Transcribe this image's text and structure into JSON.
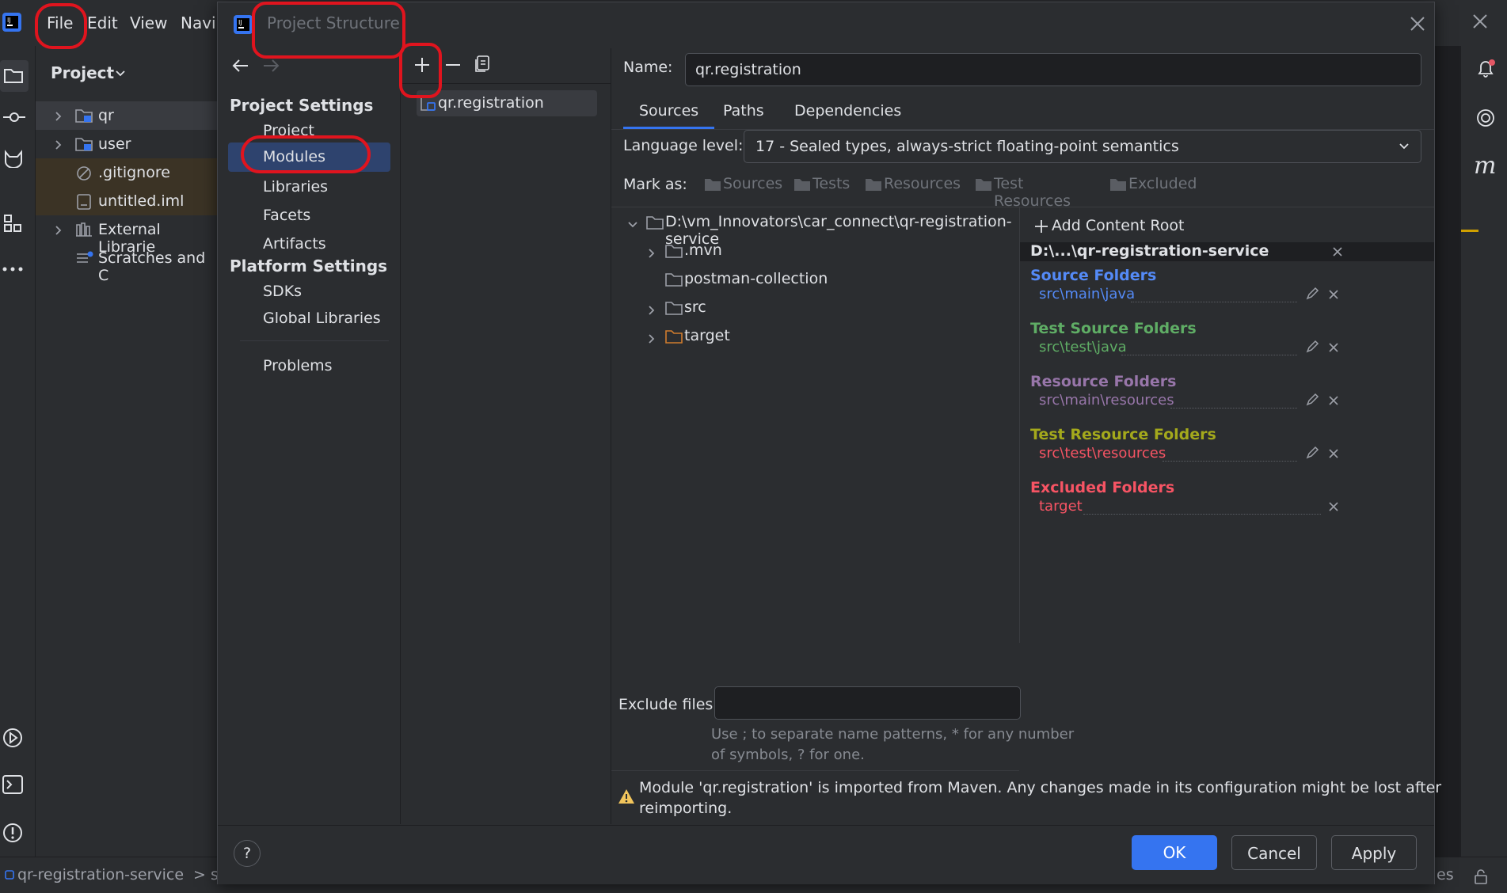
{
  "ide": {
    "menu": {
      "file": "File",
      "edit": "Edit",
      "view": "View",
      "navigate": "Navi"
    },
    "project_panel": {
      "title": "Project",
      "items": [
        {
          "label": "qr"
        },
        {
          "label": "user"
        },
        {
          "label": ".gitignore"
        },
        {
          "label": "untitled.iml"
        },
        {
          "label": "External Librarie"
        },
        {
          "label": "Scratches and C"
        }
      ]
    },
    "status_bar": {
      "breadcrumb": "qr-registration-service",
      "breadcrumb_next": "s",
      "right_text": "es"
    }
  },
  "dialog": {
    "title": "Project Structure",
    "nav": {
      "project_settings_heading": "Project Settings",
      "project_settings": [
        {
          "label": "Project"
        },
        {
          "label": "Modules"
        },
        {
          "label": "Libraries"
        },
        {
          "label": "Facets"
        },
        {
          "label": "Artifacts"
        }
      ],
      "platform_settings_heading": "Platform Settings",
      "platform_settings": [
        {
          "label": "SDKs"
        },
        {
          "label": "Global Libraries"
        }
      ],
      "problems": "Problems",
      "selected": "Modules"
    },
    "modules": [
      {
        "label": "qr.registration"
      }
    ],
    "detail": {
      "name_label": "Name:",
      "name_value": "qr.registration",
      "tabs": [
        {
          "label": "Sources"
        },
        {
          "label": "Paths"
        },
        {
          "label": "Dependencies"
        }
      ],
      "active_tab": "Sources",
      "language_level_label": "Language level:",
      "language_level_value": "17 - Sealed types, always-strict floating-point semantics",
      "mark_as_label": "Mark as:",
      "mark_as": [
        {
          "label": "Sources"
        },
        {
          "label": "Tests"
        },
        {
          "label": "Resources"
        },
        {
          "label": "Test Resources"
        },
        {
          "label": "Excluded"
        }
      ],
      "tree": {
        "root": "D:\\vm_Innovators\\car_connect\\qr-registration-service",
        "children": [
          {
            "label": ".mvn"
          },
          {
            "label": "postman-collection"
          },
          {
            "label": "src"
          },
          {
            "label": "target"
          }
        ]
      },
      "content_root": {
        "add_label": "Add Content Root",
        "path": "D:\\...\\qr-registration-service",
        "groups": [
          {
            "heading": "Source Folders",
            "path": "src\\main\\java",
            "color": "#548af7"
          },
          {
            "heading": "Test Source Folders",
            "path": "src\\test\\java",
            "color": "#5fad65"
          },
          {
            "heading": "Resource Folders",
            "path": "src\\main\\resources",
            "color": "#9876aa"
          },
          {
            "heading": "Test Resource Folders",
            "path": "src\\test\\resources",
            "color": "#a4a91c"
          },
          {
            "heading": "Excluded Folders",
            "path": "target",
            "color": "#f75464"
          }
        ],
        "test_resource_path_color": "#f75464"
      },
      "exclude_files_label": "Exclude files:",
      "exclude_files_value": "",
      "exclude_hint_line1": "Use ; to separate name patterns, * for any number",
      "exclude_hint_line2": "of symbols, ? for one.",
      "warning_line1": "Module 'qr.registration' is imported from Maven. Any changes made in its configuration might be lost after",
      "warning_line2": "reimporting."
    },
    "buttons": {
      "help": "?",
      "ok": "OK",
      "cancel": "Cancel",
      "apply": "Apply"
    }
  },
  "colors": {
    "accent": "#3574f0",
    "selection": "#2e436e",
    "annotation": "#e0141e",
    "folder_target": "#d07c2e",
    "warning": "#f2c55c"
  }
}
